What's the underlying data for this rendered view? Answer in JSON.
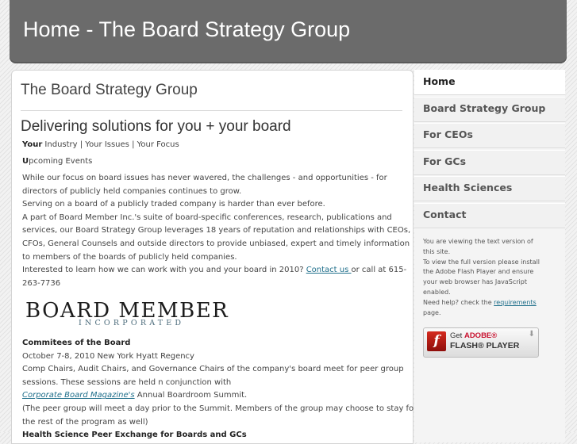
{
  "header": {
    "title": "Home - The Board Strategy Group"
  },
  "main": {
    "page_title": "The Board Strategy Group",
    "subtitle": "Delivering solutions for you + your board",
    "line_focus": {
      "bold": "Your",
      "rest": " Industry | Your Issues | Your Focus"
    },
    "line_events": {
      "bold": "U",
      "rest": "pcoming Events"
    },
    "para1_a": "While our focus on board issues has never wavered, the challenges - and opportunities - for",
    "para1_b": "directors of publicly held companies continues to grow.",
    "para2": "Serving on a board of a publicly traded company is harder than ever before.",
    "para3_a": "A part of Board Member Inc.'s suite of board-specific conferences, research, publications and",
    "para3_b": "services, our Board Strategy Group leverages 18 years of reputation and relationships with CEOs,",
    "para3_c": "CFOs, General Counsels and outside directors to provide unbiased, expert and timely information",
    "para3_d": "to members of the boards of publicly held companies.",
    "interest_text": "Interested to learn how we can work with you and your board in 2010? ",
    "contact_link": "Contact us ",
    "interest_tail": "or call at 615-",
    "phone_tail": "263-7736",
    "logo_main": "BOARD MEMBER",
    "logo_sub": "INCORPORATED",
    "committees_heading": "Commitees of the Board",
    "committees_date": "October 7-8, 2010 New York Hyatt Regency",
    "committees_p1_a": "Comp Chairs, Audit Chairs, and Governance Chairs of the company's board meet for peer group",
    "committees_p1_b": "sessions. These sessions are held n conjunction with",
    "cbm_link": "Corporate Board Magazine's",
    "cbm_tail": " Annual Boardroom Summit.",
    "committees_p2_a": "(The peer group will meet a day prior to the Summit. Members of the group may choose to stay for",
    "committees_p2_b": "the rest of the program as well)",
    "cut_heading": "Health Science Peer Exchange for Boards and GCs"
  },
  "sidebar": {
    "nav": [
      {
        "label": "Home",
        "active": true
      },
      {
        "label": "Board Strategy Group",
        "active": false
      },
      {
        "label": "For CEOs",
        "active": false
      },
      {
        "label": "For GCs",
        "active": false
      },
      {
        "label": "Health Sciences",
        "active": false
      },
      {
        "label": "Contact",
        "active": false
      }
    ],
    "note_1": "You are viewing the text version of",
    "note_2": "this site.",
    "note_3": "To view the full version please install",
    "note_4": "the Adobe Flash Player and ensure",
    "note_5": "your web browser has JavaScript",
    "note_6": "enabled.",
    "note_7": "Need help? check the ",
    "requirements_link": "requirements",
    "note_8": "page.",
    "flash_get": "Get ",
    "flash_adobe": "ADOBE®",
    "flash_player": "FLASH® PLAYER",
    "flash_icon_glyph": "f"
  },
  "colors": {
    "header_bg": "#6b6b6b",
    "link": "#1f6f8b",
    "flash_red": "#c8102e"
  }
}
